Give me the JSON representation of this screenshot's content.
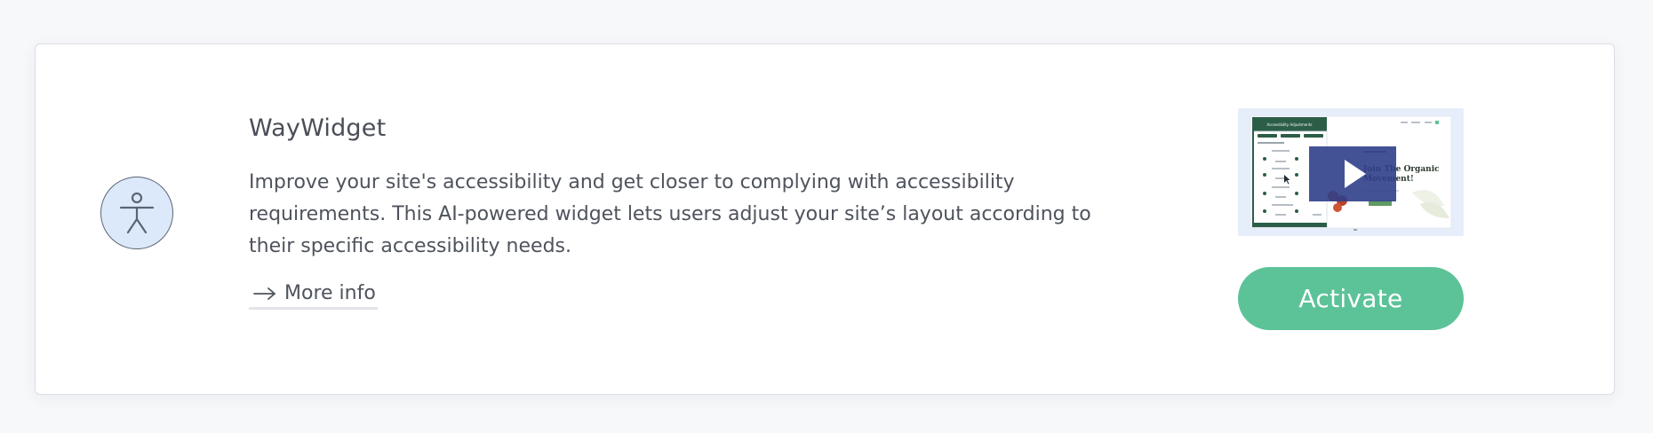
{
  "app": {
    "name": "WayWidget",
    "description": "Improve your site's accessibility and get closer to complying with accessibility requirements. This AI-powered widget lets users adjust your site’s layout according to their specific accessibility needs.",
    "more_info_label": "More info",
    "activate_label": "Activate",
    "icon": "accessibility-person-icon"
  },
  "preview": {
    "headline": "Join The Organic Movement!",
    "panel_title": "Accessibility Adjustments",
    "play_icon": "play-icon"
  },
  "colors": {
    "accent": "#5cc398",
    "icon_bg": "#dce9fb",
    "play_overlay": "#2f3f8a",
    "panel_green": "#2c5e47"
  }
}
